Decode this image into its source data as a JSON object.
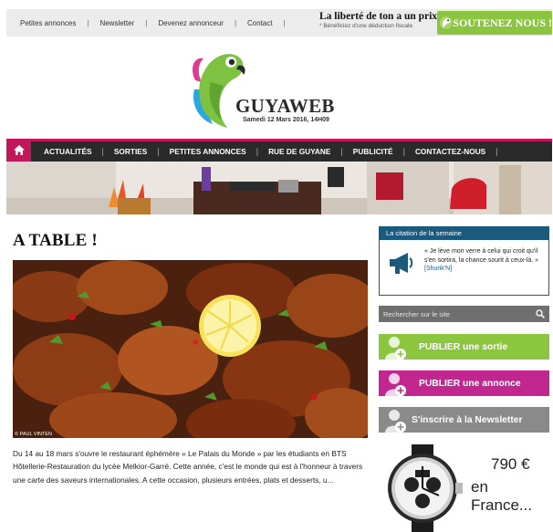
{
  "topbar": {
    "links": [
      "Petites annonces",
      "Newsletter",
      "Devenez annonceur",
      "Contact"
    ],
    "promo_line1": "La liberté de ton a un prix",
    "promo_line2": "Bénéficiez d'une déduction fiscale",
    "promo_star": "*",
    "support_label": "SOUTENEZ NOUS !"
  },
  "logo": {
    "name": "GUYAWEB",
    "date": "Samedi 12 Mars 2016, 14H09"
  },
  "nav": {
    "items": [
      "ACTUALITÉS",
      "SORTIES",
      "PETITES ANNONCES",
      "RUE DE GUYANE",
      "PUBLICITÉ",
      "CONTACTEZ-NOUS"
    ]
  },
  "article": {
    "title": "A TABLE !",
    "photo_credit": "© PAUL VINTEN",
    "excerpt": "Du 14 au 18 mars s'ouvre le restaurant éphémère « Le Palais du Monde » par les étudiants en BTS Hôtellerie-Restauration du lycée Melkior-Garré. Cette année, c'est le monde qui est à l'honneur à travers une carte des saveurs internationales.  A cette occasion, plusieurs entrées, plats et desserts, u..."
  },
  "sidebar": {
    "quote_title": "La citation de la semaine",
    "quote_text": "« Je lève mon verre à celui qui croit qu'il s'en sortira, la chance sourit à ceux-là. »",
    "quote_author": "[Shurik'N]",
    "search_placeholder": "Rechercher sur le site",
    "buttons": [
      {
        "label": "PUBLIER une sortie",
        "color": "#8cc63f"
      },
      {
        "label": "PUBLIER une annonce",
        "color": "#c2278f"
      },
      {
        "label": "S'inscrire à la Newsletter",
        "color": "#8a8a8a"
      }
    ],
    "ad_price": "790 €",
    "ad_sub": "en France..."
  },
  "colors": {
    "accent": "#c2185b",
    "nav_bg": "#2a2a2a",
    "support_green": "#8bc53f",
    "quote_blue": "#1b5a7c"
  }
}
